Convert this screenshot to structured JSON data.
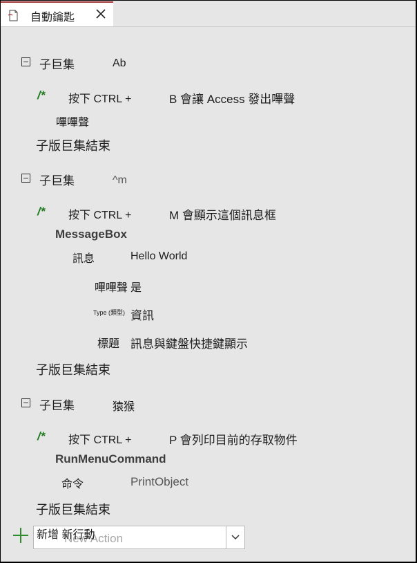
{
  "tab": {
    "title": "自動鑰匙",
    "icon": "macro-document-icon",
    "close_icon": "close-icon"
  },
  "labels": {
    "submacro": "子巨集",
    "end_submacro": "子版巨集結束",
    "comment_open": "/*"
  },
  "submacros": [
    {
      "name": "Ab",
      "comment_key": "按下 CTRL +",
      "comment_text": "B 會讓 Access 發出嗶聲",
      "action_label": "嗶嗶聲"
    },
    {
      "name": "^m",
      "comment_key": "按下 CTRL +",
      "comment_text": "M 會顯示這個訊息框",
      "action": "MessageBox",
      "arguments": [
        {
          "label": "訊息",
          "value": "Hello World"
        },
        {
          "label": "嗶嗶聲",
          "value": "是"
        },
        {
          "label": "Type (類型)",
          "value": "資訊"
        },
        {
          "label": "標題",
          "value": "訊息與鍵盤快捷鍵顯示"
        }
      ]
    },
    {
      "name": "猿猴",
      "comment_key": "按下 CTRL +",
      "comment_text": "P 會列印目前的存取物件",
      "action": "RunMenuCommand",
      "arguments": [
        {
          "label": "命令",
          "value": "PrintObject"
        }
      ]
    }
  ],
  "add_action": {
    "label": "新增 新行動",
    "placeholder": "New Action",
    "icon": "plus-icon",
    "dropdown_icon": "chevron-down-icon"
  },
  "colors": {
    "tab_accent": "#a4373a",
    "comment": "#1e7b1e",
    "add_plus": "#2e8b2e"
  }
}
